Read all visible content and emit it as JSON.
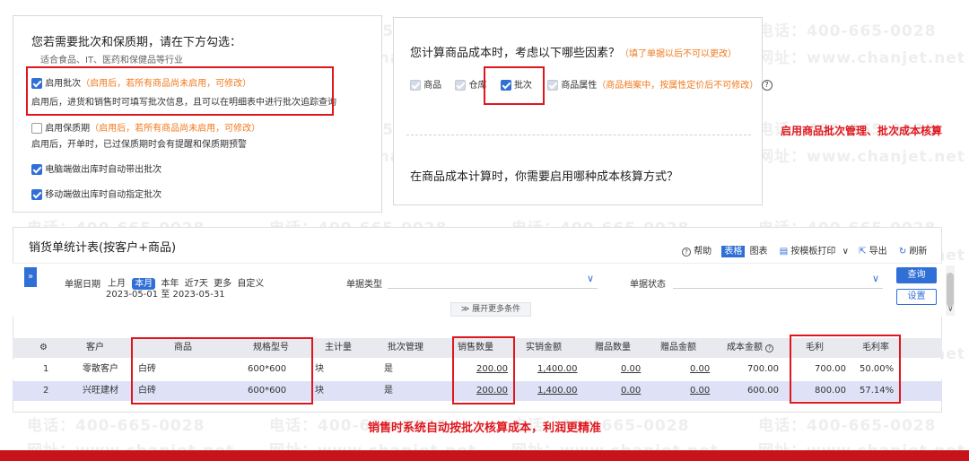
{
  "watermark": {
    "phone": "电话：400-665-0028",
    "site": "网址：www.chanjet.net"
  },
  "left_panel": {
    "title": "您若需要批次和保质期，请在下方勾选：",
    "subtitle": "适合食品、IT、医药和保健品等行业",
    "batch_label": "启用批次",
    "batch_note": "（启用后，若所有商品尚未启用，可修改）",
    "batch_desc": "启用后，进货和销售时可填写批次信息，且可以在明细表中进行批次追踪查询",
    "shelf_label": "启用保质期",
    "shelf_note": "（启用后，若所有商品尚未启用，可修改）",
    "shelf_desc": "启用后，开单时，已过保质期时会有提醒和保质期预警",
    "pc_auto_label": "电脑端做出库时自动带出批次",
    "mobile_auto_label": "移动端做出库时自动指定批次"
  },
  "right_panel": {
    "question1": "您计算商品成本时，考虑以下哪些因素？",
    "question1_note": "（填了单据以后不可以更改）",
    "opt_goods": "商品",
    "opt_warehouse": "仓库",
    "opt_batch": "批次",
    "opt_attr": "商品属性",
    "opt_attr_note": "（商品档案中，按属性定价后不可修改）",
    "help_icon": "question-circle-icon",
    "question2": "在商品成本计算时，你需要启用哪种成本核算方式？"
  },
  "callout_right": "启用商品批次管理、批次成本核算",
  "report": {
    "title": "销货单统计表(按客户+商品)",
    "toolbar": {
      "help": "帮助",
      "table": "表格",
      "chart": "图表",
      "print": "按模板打印",
      "export": "导出",
      "refresh": "刷新"
    },
    "filter": {
      "date_label": "单据日期",
      "date_opts": [
        "上月",
        "本月",
        "本年",
        "近7天",
        "更多",
        "自定义"
      ],
      "date_range": "2023-05-01 至 2023-05-31",
      "type_label": "单据类型",
      "status_label": "单据状态",
      "query_btn": "查询",
      "settings_btn": "设置",
      "expand": "展开更多条件"
    },
    "columns": [
      "客户",
      "商品",
      "规格型号",
      "主计量",
      "批次管理",
      "销售数量",
      "实销金额",
      "赠品数量",
      "赠品金额",
      "成本金额",
      "毛利",
      "毛利率"
    ],
    "rows": [
      {
        "idx": "1",
        "customer": "零散客户",
        "product": "白砖",
        "spec": "600*600",
        "unit": "块",
        "batch": "是",
        "qty": "200.00",
        "amount": "1,400.00",
        "gift_qty": "0.00",
        "gift_amt": "0.00",
        "cost": "700.00",
        "profit": "700.00",
        "rate": "50.00%"
      },
      {
        "idx": "2",
        "customer": "兴旺建材",
        "product": "白砖",
        "spec": "600*600",
        "unit": "块",
        "batch": "是",
        "qty": "200.00",
        "amount": "1,400.00",
        "gift_qty": "0.00",
        "gift_amt": "0.00",
        "cost": "600.00",
        "profit": "800.00",
        "rate": "57.14%"
      }
    ]
  },
  "callout_bottom": "销售时系统自动按批次核算成本，利润更精准",
  "colors": {
    "accent": "#2f6fd6",
    "highlight_red": "#e0161d",
    "orange_note": "#f07a1e",
    "bottom_bar": "#c8131a"
  }
}
